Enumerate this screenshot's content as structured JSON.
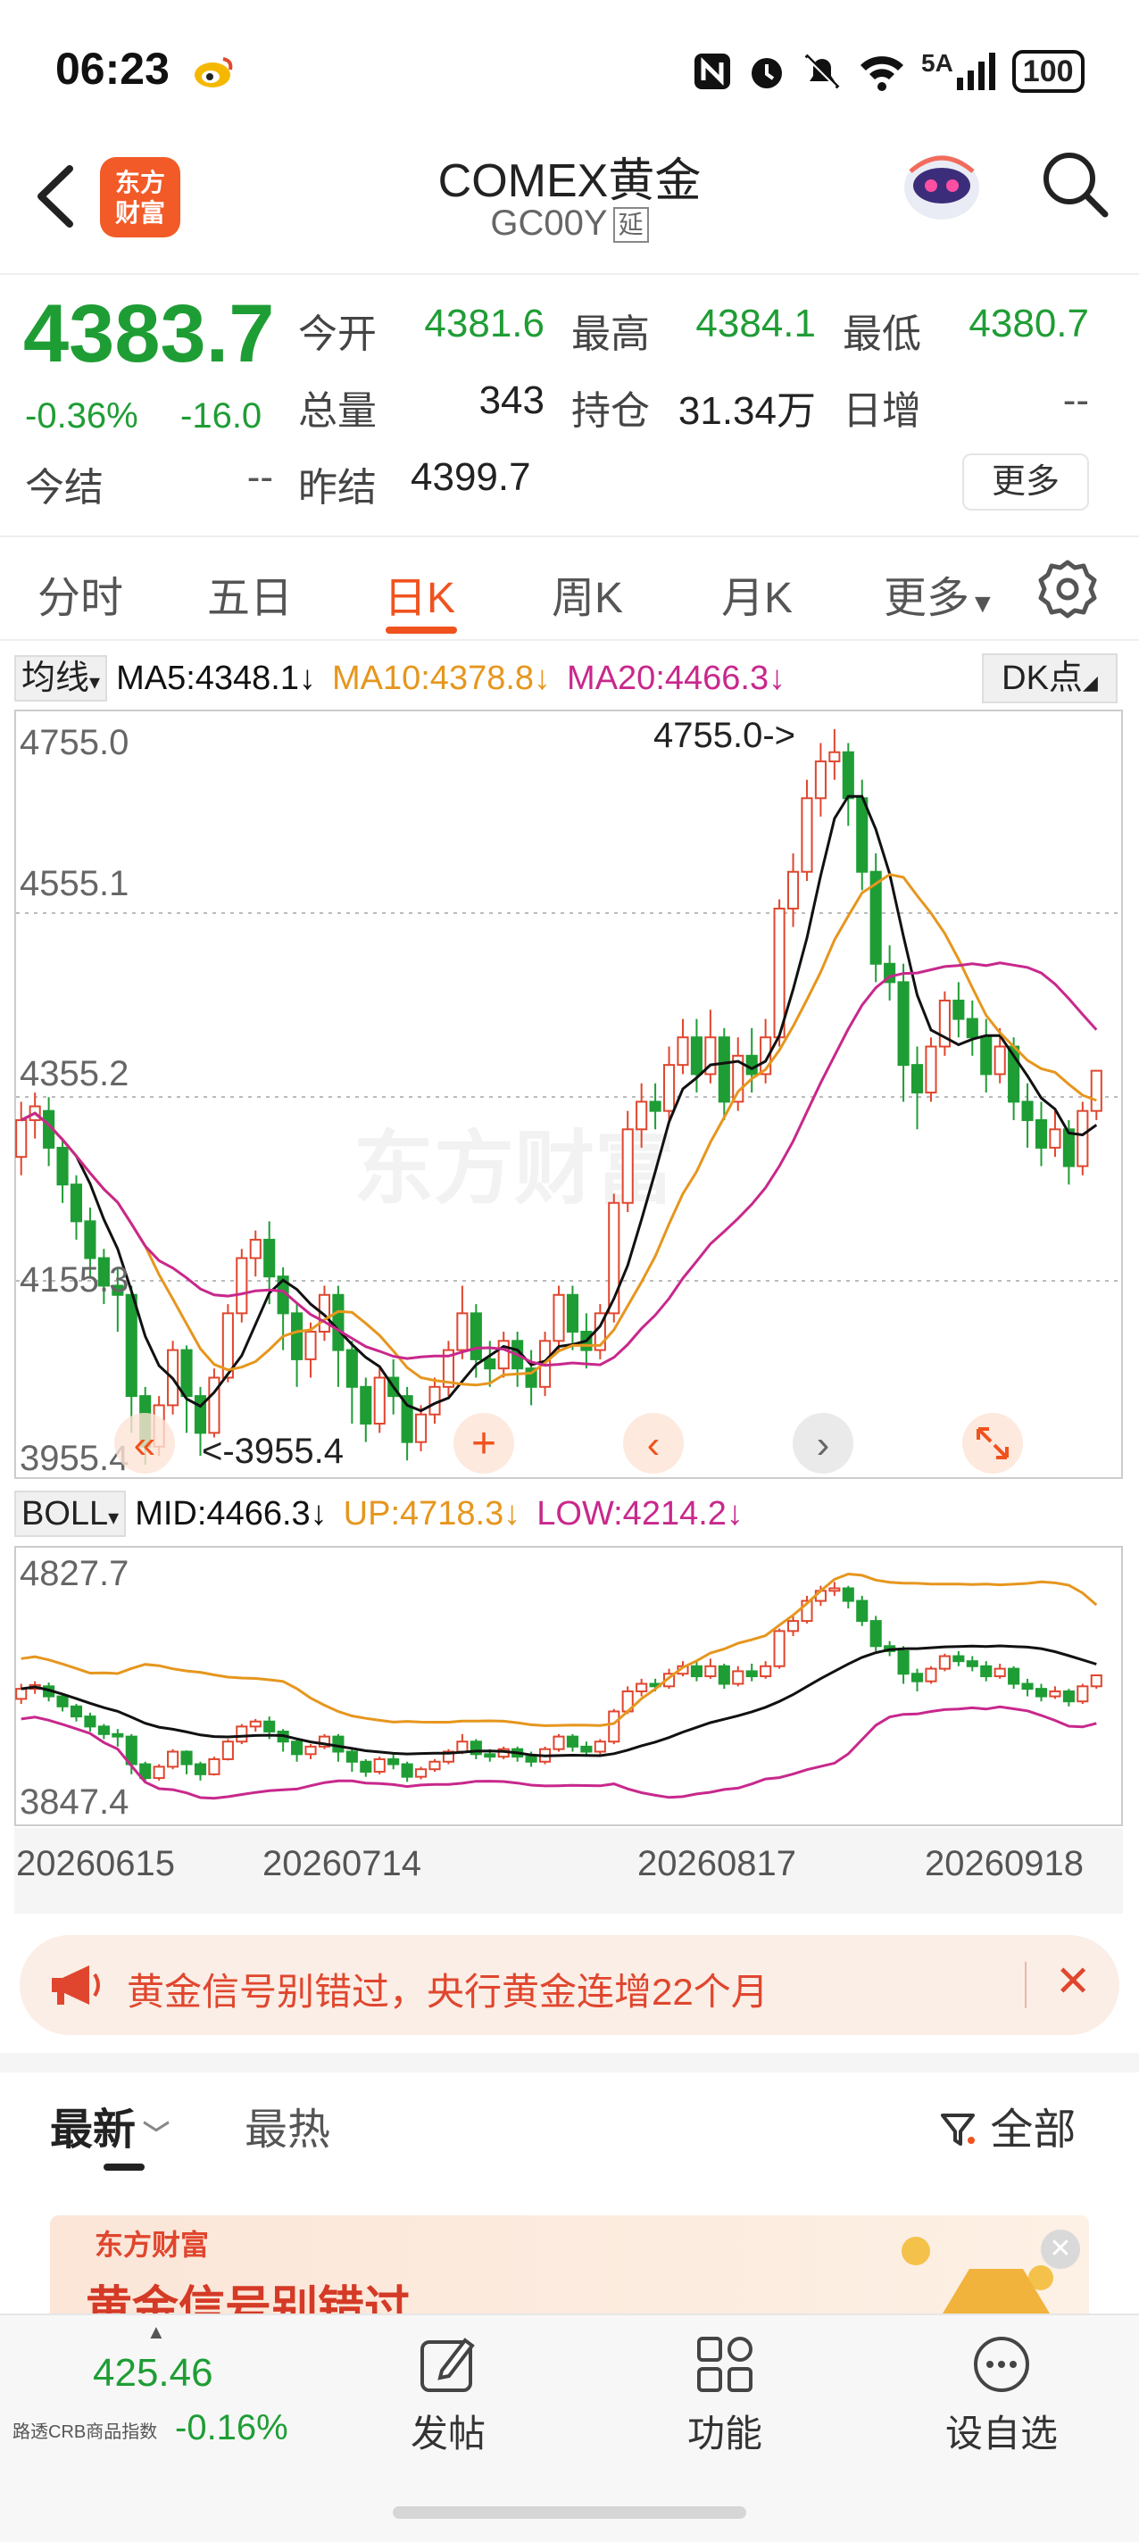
{
  "status_bar": {
    "time": "06:23",
    "network": "5A",
    "battery": "100"
  },
  "header": {
    "title": "COMEX黄金",
    "subtitle": "GC00Y",
    "delay_badge": "延",
    "logo_line1": "东方",
    "logo_line2": "财富"
  },
  "quote": {
    "last_price": "4383.7",
    "change_pct": "-0.36%",
    "change_abs": "-16.0",
    "fields": {
      "open_label": "今开",
      "open": "4381.6",
      "high_label": "最高",
      "high": "4384.1",
      "low_label": "最低",
      "low": "4380.7",
      "volume_label": "总量",
      "volume": "343",
      "oi_label": "持仓",
      "oi": "31.34万",
      "daily_inc_label": "日增",
      "daily_inc": "--",
      "settle_label": "今结",
      "settle": "--",
      "prev_settle_label": "昨结",
      "prev_settle": "4399.7"
    },
    "more_label": "更多"
  },
  "tabs": {
    "items": [
      "分时",
      "五日",
      "日K",
      "周K",
      "月K",
      "更多"
    ],
    "active": "日K"
  },
  "ma_row": {
    "select": "均线",
    "ma5": "MA5:4348.1",
    "ma10": "MA10:4378.8",
    "ma20": "MA20:4466.3",
    "dk_button": "DK点"
  },
  "boll_row": {
    "select": "BOLL",
    "mid": "MID:4466.3",
    "up": "UP:4718.3",
    "low": "LOW:4214.2"
  },
  "kline_axis": {
    "labels": [
      "4755.0",
      "4555.1",
      "4355.2",
      "4155.3",
      "3955.4"
    ],
    "max_marker": "4755.0->",
    "min_marker": "<-3955.4"
  },
  "boll_axis": {
    "top": "4827.7",
    "bottom": "3847.4"
  },
  "date_axis": [
    "20260615",
    "20260714",
    "20260817",
    "20260918"
  ],
  "colors": {
    "up": "#e0462e",
    "down": "#1f9d35",
    "ma5": "#111111",
    "ma10": "#e6961e",
    "ma20": "#c8288c",
    "accent": "#f0521e"
  },
  "chart_data": {
    "type": "candlestick",
    "ylim": [
      3955.4,
      4755.0
    ],
    "candles": [
      [
        4290,
        4330,
        4270,
        4350
      ],
      [
        4330,
        4345,
        4310,
        4360
      ],
      [
        4340,
        4300,
        4280,
        4355
      ],
      [
        4300,
        4260,
        4240,
        4310
      ],
      [
        4260,
        4220,
        4200,
        4270
      ],
      [
        4220,
        4180,
        4160,
        4235
      ],
      [
        4180,
        4150,
        4130,
        4190
      ],
      [
        4150,
        4140,
        4100,
        4170
      ],
      [
        4140,
        4030,
        3990,
        4150
      ],
      [
        4030,
        3975,
        3955.4,
        4040
      ],
      [
        3975,
        4020,
        3965,
        4030
      ],
      [
        4020,
        4080,
        4010,
        4090
      ],
      [
        4080,
        4030,
        3990,
        4085
      ],
      [
        4030,
        3990,
        3965,
        4040
      ],
      [
        3990,
        4050,
        3985,
        4060
      ],
      [
        4050,
        4120,
        4045,
        4130
      ],
      [
        4120,
        4180,
        4110,
        4190
      ],
      [
        4180,
        4200,
        4160,
        4210
      ],
      [
        4200,
        4160,
        4130,
        4220
      ],
      [
        4160,
        4120,
        4080,
        4170
      ],
      [
        4120,
        4070,
        4040,
        4130
      ],
      [
        4070,
        4100,
        4050,
        4110
      ],
      [
        4100,
        4140,
        4090,
        4150
      ],
      [
        4140,
        4080,
        4040,
        4150
      ],
      [
        4080,
        4040,
        4000,
        4090
      ],
      [
        4040,
        4000,
        3980,
        4050
      ],
      [
        4000,
        4050,
        3990,
        4060
      ],
      [
        4050,
        4030,
        4010,
        4070
      ],
      [
        4030,
        3980,
        3960,
        4040
      ],
      [
        3980,
        4010,
        3970,
        4020
      ],
      [
        4010,
        4040,
        4000,
        4050
      ],
      [
        4040,
        4080,
        4030,
        4090
      ],
      [
        4080,
        4120,
        4070,
        4150
      ],
      [
        4120,
        4070,
        4050,
        4130
      ],
      [
        4070,
        4060,
        4040,
        4090
      ],
      [
        4060,
        4090,
        4050,
        4100
      ],
      [
        4090,
        4060,
        4040,
        4100
      ],
      [
        4060,
        4040,
        4020,
        4080
      ],
      [
        4040,
        4090,
        4030,
        4100
      ],
      [
        4090,
        4140,
        4080,
        4150
      ],
      [
        4140,
        4100,
        4080,
        4150
      ],
      [
        4100,
        4080,
        4060,
        4120
      ],
      [
        4080,
        4120,
        4070,
        4130
      ],
      [
        4120,
        4240,
        4110,
        4250
      ],
      [
        4240,
        4320,
        4230,
        4340
      ],
      [
        4320,
        4350,
        4300,
        4370
      ],
      [
        4350,
        4340,
        4320,
        4370
      ],
      [
        4340,
        4390,
        4330,
        4410
      ],
      [
        4390,
        4420,
        4380,
        4440
      ],
      [
        4420,
        4380,
        4360,
        4440
      ],
      [
        4380,
        4420,
        4370,
        4450
      ],
      [
        4420,
        4350,
        4330,
        4430
      ],
      [
        4350,
        4400,
        4340,
        4420
      ],
      [
        4400,
        4380,
        4360,
        4430
      ],
      [
        4380,
        4420,
        4370,
        4440
      ],
      [
        4420,
        4560,
        4410,
        4570
      ],
      [
        4560,
        4600,
        4540,
        4620
      ],
      [
        4600,
        4680,
        4590,
        4700
      ],
      [
        4680,
        4720,
        4660,
        4740
      ],
      [
        4720,
        4730,
        4700,
        4755.0
      ],
      [
        4730,
        4680,
        4650,
        4740
      ],
      [
        4680,
        4600,
        4580,
        4700
      ],
      [
        4600,
        4500,
        4480,
        4620
      ],
      [
        4500,
        4480,
        4460,
        4520
      ],
      [
        4480,
        4390,
        4350,
        4500
      ],
      [
        4390,
        4360,
        4320,
        4410
      ],
      [
        4360,
        4410,
        4350,
        4420
      ],
      [
        4410,
        4460,
        4400,
        4470
      ],
      [
        4460,
        4440,
        4420,
        4480
      ],
      [
        4440,
        4420,
        4400,
        4460
      ],
      [
        4420,
        4380,
        4360,
        4440
      ],
      [
        4380,
        4410,
        4370,
        4430
      ],
      [
        4410,
        4350,
        4330,
        4420
      ],
      [
        4350,
        4330,
        4300,
        4370
      ],
      [
        4330,
        4300,
        4280,
        4350
      ],
      [
        4300,
        4320,
        4290,
        4340
      ],
      [
        4320,
        4280,
        4260,
        4330
      ],
      [
        4280,
        4340,
        4270,
        4350
      ],
      [
        4340,
        4383.7,
        4330,
        4384.1
      ]
    ]
  },
  "promo": {
    "text": "黄金信号别错过，央行黄金连增22个月"
  },
  "feed": {
    "tab_latest": "最新",
    "tab_hot": "最热",
    "filter": "全部",
    "card_brand": "东方财富",
    "card_title": "黄金信号别错过"
  },
  "bottom_bar": {
    "index_value": "425.46",
    "index_name": "路透CRB商品指数",
    "index_change": "-0.16%",
    "post_label": "发帖",
    "func_label": "功能",
    "watch_label": "设自选"
  }
}
